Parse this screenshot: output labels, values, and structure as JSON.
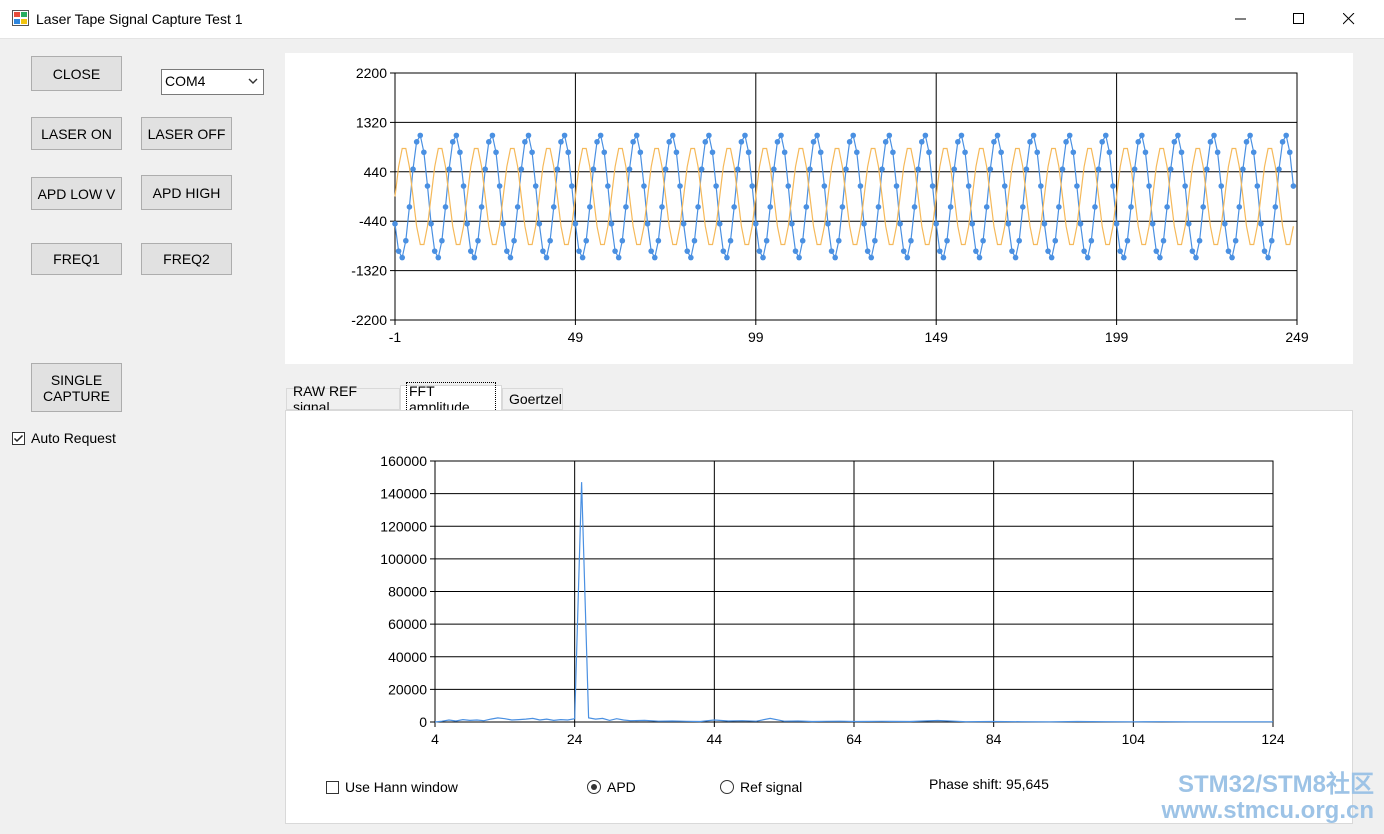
{
  "window": {
    "title": "Laser Tape Signal Capture Test 1",
    "minimize_glyph": "—",
    "maximize_glyph": "☐",
    "close_glyph": "✕"
  },
  "controls": {
    "close_label": "CLOSE",
    "port_value": "COM4",
    "laser_on_label": "LASER ON",
    "laser_off_label": "LASER OFF",
    "apd_low_label": "APD LOW V",
    "apd_high_label": "APD HIGH",
    "freq1_label": "FREQ1",
    "freq2_label": "FREQ2",
    "single_capture_label_1": "SINGLE",
    "single_capture_label_2": "CAPTURE",
    "auto_request_label": "Auto Request",
    "auto_request_checked": true
  },
  "tabs": [
    {
      "label": "RAW REF signal",
      "active": false
    },
    {
      "label": "FFT amplitude",
      "active": true
    },
    {
      "label": "Goertzel",
      "active": false
    }
  ],
  "fft_options": {
    "hann_label": "Use Hann window",
    "hann_checked": false,
    "apd_label": "APD",
    "ref_label": "Ref signal",
    "selected": "APD",
    "phase_shift": "Phase shift: 95,645"
  },
  "watermark": {
    "line1": "STM32/STM8社区",
    "line2": "www.stmcu.org.cn"
  },
  "colors": {
    "apd_series": "#4a90e2",
    "ref_series": "#f5b95a",
    "button_face": "#e1e1e1"
  },
  "chart_data": [
    {
      "type": "line",
      "xlim": [
        -1,
        249
      ],
      "ylim": [
        -2200,
        2200
      ],
      "x_ticks": [
        -1,
        49,
        99,
        149,
        199,
        249
      ],
      "y_ticks": [
        2200,
        1320,
        440,
        -440,
        -1320,
        -2200
      ],
      "x_tick_labels": [
        "-1",
        "49",
        "99",
        "149",
        "199",
        "249"
      ],
      "y_tick_labels": [
        "2200",
        "1320",
        "440",
        "-440",
        "-1320",
        "-2200"
      ],
      "grid": true,
      "series": [
        {
          "color": "#4a90e2",
          "markers": true,
          "kind": "sine",
          "samples": 250,
          "amplitude": 1100,
          "period": 10,
          "offset": 0,
          "phase": 3.6
        },
        {
          "color": "#f5b95a",
          "markers": false,
          "kind": "sine",
          "samples": 250,
          "amplitude": 900,
          "period": 10,
          "offset": 0,
          "phase": 0.0
        }
      ]
    },
    {
      "type": "line",
      "xlim": [
        4,
        124
      ],
      "ylim": [
        0,
        160000
      ],
      "x_ticks": [
        4,
        24,
        44,
        64,
        84,
        104,
        124
      ],
      "y_ticks": [
        160000,
        140000,
        120000,
        100000,
        80000,
        60000,
        40000,
        20000,
        0
      ],
      "x_tick_labels": [
        "4",
        "24",
        "44",
        "64",
        "84",
        "104",
        "124"
      ],
      "y_tick_labels": [
        "160000",
        "140000",
        "120000",
        "100000",
        "80000",
        "60000",
        "40000",
        "20000",
        "0"
      ],
      "grid": true,
      "series": [
        {
          "color": "#4a90e2",
          "x": [
            4,
            5,
            6,
            7,
            8,
            9,
            10,
            11,
            12,
            13,
            14,
            15,
            16,
            17,
            18,
            19,
            20,
            21,
            22,
            23,
            24,
            25,
            26,
            27,
            28,
            29,
            30,
            31,
            32,
            34,
            36,
            38,
            40,
            42,
            44,
            46,
            48,
            50,
            52,
            54,
            56,
            58,
            60,
            62,
            64,
            68,
            72,
            76,
            80,
            84,
            88,
            92,
            96,
            100,
            104,
            108,
            112,
            116,
            120,
            124
          ],
          "values": [
            0,
            500,
            1200,
            600,
            1500,
            1000,
            1200,
            800,
            1800,
            2500,
            2000,
            1200,
            1500,
            1800,
            2200,
            1200,
            1800,
            1000,
            1500,
            1200,
            2000,
            147000,
            2500,
            1800,
            2200,
            1000,
            2000,
            1200,
            800,
            1000,
            500,
            600,
            400,
            300,
            1200,
            600,
            800,
            500,
            2200,
            500,
            600,
            300,
            400,
            500,
            300,
            400,
            300,
            900,
            200,
            300,
            200,
            150,
            300,
            200,
            150,
            200,
            100,
            150,
            100,
            100
          ]
        }
      ]
    }
  ]
}
